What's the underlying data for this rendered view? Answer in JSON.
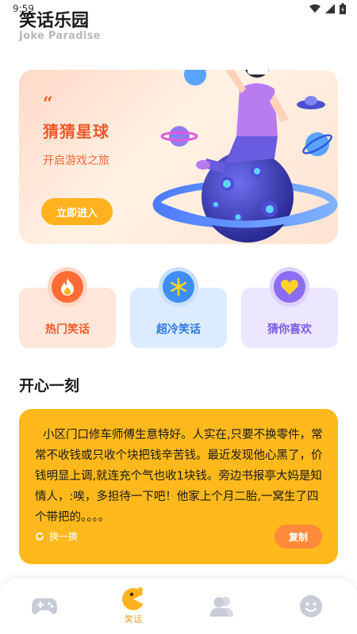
{
  "status": {
    "time": "9:59"
  },
  "header": {
    "title": "笑话乐园",
    "subtitle": "Joke Paradise"
  },
  "banner": {
    "quote_mark": "“",
    "title": "猜猜星球",
    "subtitle": "开启游戏之旅",
    "button_label": "立即进入"
  },
  "categories": [
    {
      "label": "热门笑话",
      "icon": "fire-icon"
    },
    {
      "label": "超冷笑话",
      "icon": "snowflake-icon"
    },
    {
      "label": "猜你喜欢",
      "icon": "heart-icon"
    }
  ],
  "section": {
    "title": "开心一刻"
  },
  "joke": {
    "text": "小区门口修车师傅生意特好。人实在,只要不换零件，常常不收钱或只收个块把钱辛苦钱。最近发现他心黑了，价钱明显上调,就连充个气也收1块钱。旁边书报亭大妈是知情人，:唉，多担待一下吧！他家上个月二胎,一窝生了四个带把的。。。。",
    "refresh_label": "换一换",
    "copy_label": "复制"
  },
  "tabbar": {
    "items": [
      {
        "icon": "gamepad-icon",
        "label": ""
      },
      {
        "icon": "laugh-icon",
        "label": "笑话",
        "active": true
      },
      {
        "icon": "users-icon",
        "label": ""
      },
      {
        "icon": "smiley-icon",
        "label": ""
      }
    ]
  },
  "colors": {
    "accent": "#ffb91c",
    "brand_orange": "#f05a2a",
    "blue": "#3f8ef5",
    "purple": "#8c6cf0"
  }
}
